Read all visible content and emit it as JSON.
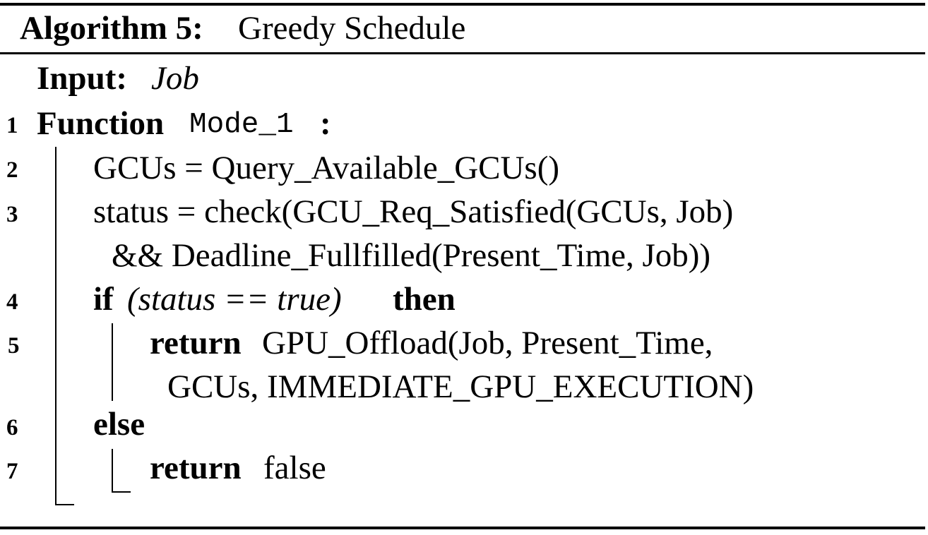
{
  "algorithm": {
    "header_label": "Algorithm 5:",
    "title": "Greedy Schedule",
    "input_label": "Input:",
    "input_value": "Job",
    "lines": [
      {
        "num": "1",
        "keyword": "Function",
        "name": "Mode_1",
        "suffix": ":"
      },
      {
        "num": "2",
        "text": "GCUs = Query_Available_GCUs()"
      },
      {
        "num": "3",
        "text": "status = check(GCU_Req_Satisfied(GCUs, Job)",
        "cont": "&& Deadline_Fullfilled(Present_Time, Job))"
      },
      {
        "num": "4",
        "keyword": "if",
        "cond": "(status == true)",
        "keyword2": "then"
      },
      {
        "num": "5",
        "keyword": "return",
        "text": "GPU_Offload(Job, Present_Time,",
        "cont": "GCUs, IMMEDIATE_GPU_EXECUTION)"
      },
      {
        "num": "6",
        "keyword": "else"
      },
      {
        "num": "7",
        "keyword": "return",
        "text": "false"
      }
    ]
  }
}
